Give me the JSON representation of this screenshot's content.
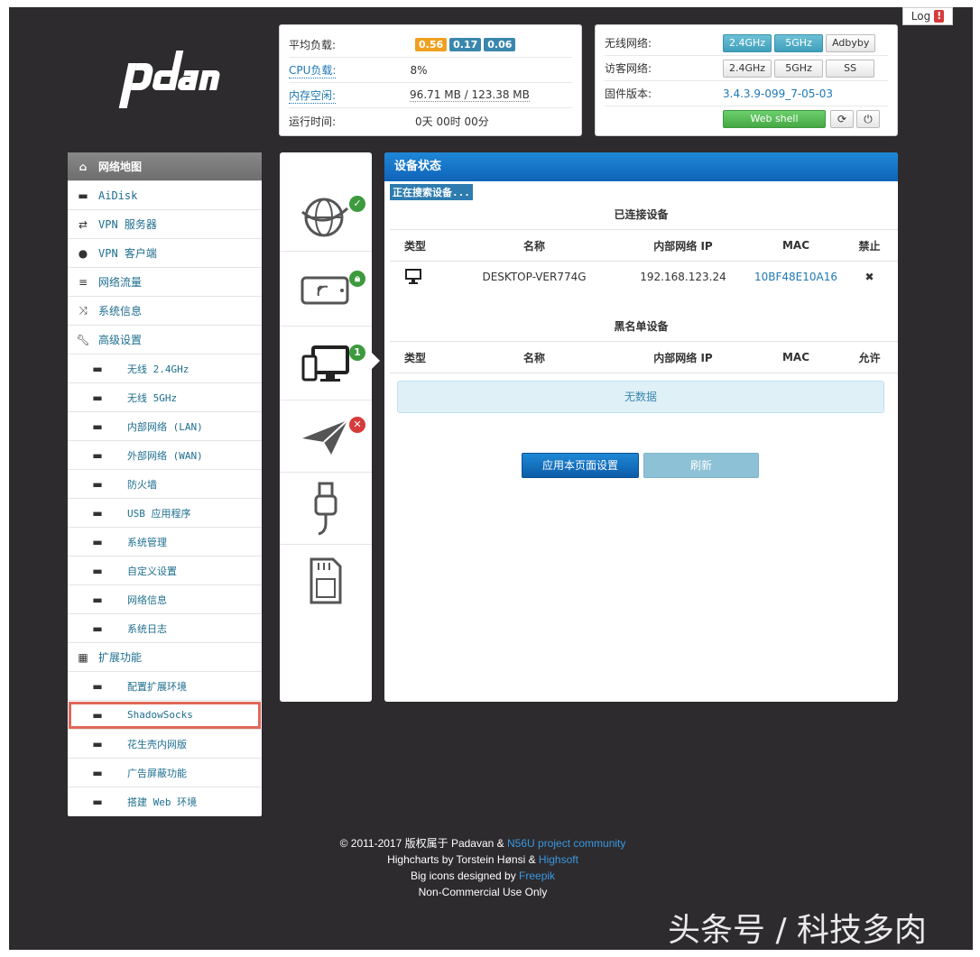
{
  "log_button": {
    "label": "Log",
    "alert": "!"
  },
  "status": {
    "load_label": "平均负载:",
    "load_values": [
      "0.56",
      "0.17",
      "0.06"
    ],
    "cpu_label": "CPU负载:",
    "cpu_value": "8%",
    "mem_label": "内存空闲:",
    "mem_value": "96.71 MB / 123.38 MB",
    "uptime_label": "运行时间:",
    "uptime_value": "0天 00时 00分"
  },
  "wireless": {
    "wifi_label": "无线网络:",
    "wifi_buttons": [
      "2.4GHz",
      "5GHz",
      "Adbyby"
    ],
    "guest_label": "访客网络:",
    "guest_buttons": [
      "2.4GHz",
      "5GHz",
      "SS"
    ],
    "firmware_label": "固件版本:",
    "firmware_value": "3.4.3.9-099_7-05-03",
    "webshell_label": "Web shell"
  },
  "sidebar": {
    "items": [
      {
        "label": "网络地图",
        "icon": "home-icon"
      },
      {
        "label": "AiDisk",
        "icon": "drive-icon"
      },
      {
        "label": "VPN 服务器",
        "icon": "retweet-icon"
      },
      {
        "label": "VPN 客户端",
        "icon": "globe-icon"
      },
      {
        "label": "网络流量",
        "icon": "list-icon"
      },
      {
        "label": "系统信息",
        "icon": "random-icon"
      },
      {
        "label": "高级设置",
        "icon": "wrench-icon"
      }
    ],
    "sub_items": [
      "无线 2.4GHz",
      "无线 5GHz",
      "内部网络 (LAN)",
      "外部网络 (WAN)",
      "防火墙",
      "USB 应用程序",
      "系统管理",
      "自定义设置",
      "网络信息",
      "系统日志"
    ],
    "ext_label": "扩展功能",
    "ext_items": [
      "配置扩展环境",
      "ShadowSocks",
      "花生壳内网版",
      "广告屏蔽功能",
      "搭建 Web 环境"
    ]
  },
  "icon_column": {
    "badges": [
      "1"
    ]
  },
  "main": {
    "title": "设备状态",
    "scanning": "正在搜索设备...",
    "connected_title": "已连接设备",
    "blacklist_title": "黑名单设备",
    "headers": {
      "type": "类型",
      "name": "名称",
      "ip": "内部网络 IP",
      "mac": "MAC",
      "block": "禁止",
      "allow": "允许"
    },
    "devices": [
      {
        "name": "DESKTOP-VER774G",
        "ip": "192.168.123.24",
        "mac": "10BF48E10A16",
        "action": "✖"
      }
    ],
    "no_data": "无数据",
    "apply_label": "应用本页面设置",
    "refresh_label": "刷新"
  },
  "footer": {
    "line1_text": "© 2011-2017 版权属于 Padavan & ",
    "line1_link": "N56U project community",
    "line2_text": "Highcharts by Torstein Hønsi & ",
    "line2_link": "Highsoft",
    "line3_text": "Big icons designed by ",
    "line3_link": "Freepik",
    "line4_text": "Non-Commercial Use Only"
  },
  "watermark": "头条号 / 科技多肉"
}
